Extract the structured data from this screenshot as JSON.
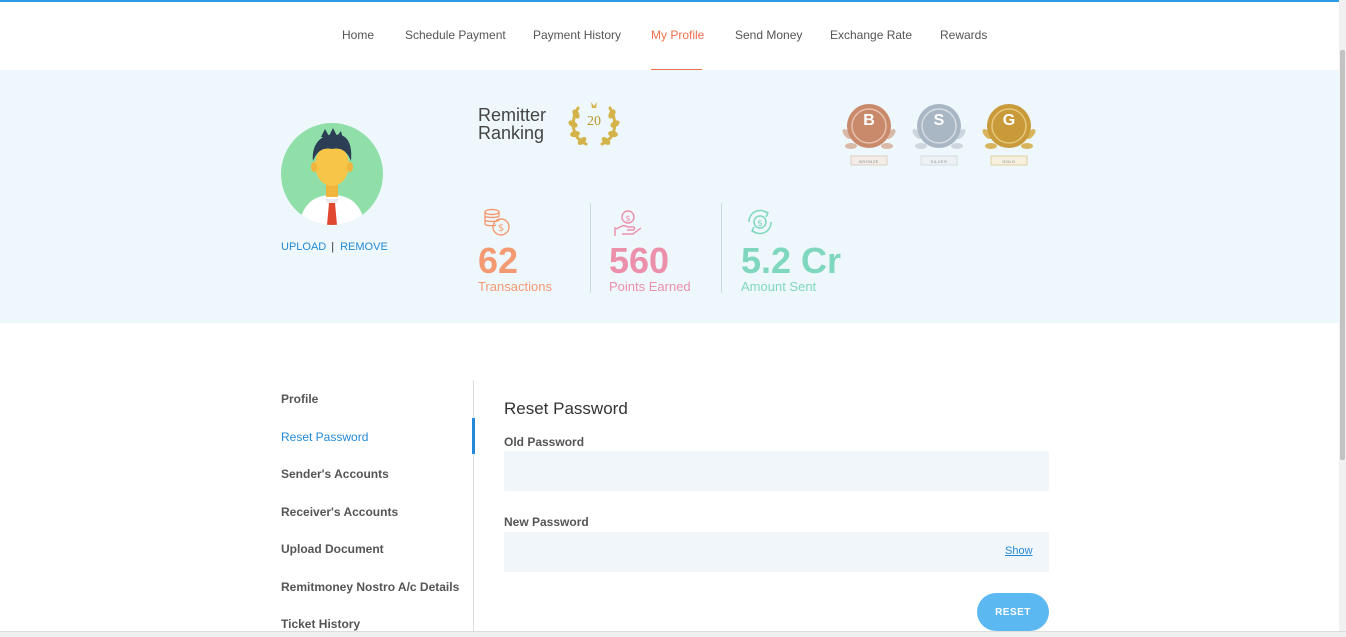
{
  "nav": {
    "items": [
      {
        "label": "Home"
      },
      {
        "label": "Schedule Payment"
      },
      {
        "label": "Payment History"
      },
      {
        "label": "My Profile"
      },
      {
        "label": "Send Money"
      },
      {
        "label": "Exchange Rate"
      },
      {
        "label": "Rewards"
      }
    ],
    "active_index": 3
  },
  "profile": {
    "upload_label": "UPLOAD",
    "separator": "|",
    "remove_label": "REMOVE"
  },
  "ranking": {
    "label_line1": "Remitter",
    "label_line2": "Ranking",
    "value": "20"
  },
  "medals": [
    {
      "letter": "B",
      "caption": "BRONZE",
      "color": "#c98a6c"
    },
    {
      "letter": "S",
      "caption": "SILVER",
      "color": "#a9b6c4"
    },
    {
      "letter": "G",
      "caption": "GOLD",
      "color": "#c99a3a"
    }
  ],
  "stats": [
    {
      "value": "62",
      "label": "Transactions",
      "color": "#f49a72",
      "icon": "coins-icon"
    },
    {
      "value": "560",
      "label": "Points Earned",
      "color": "#ec8faa",
      "icon": "hand-coin-icon"
    },
    {
      "value": "5.2 Cr",
      "label": "Amount Sent",
      "color": "#7fd7c0",
      "icon": "money-cycle-icon"
    }
  ],
  "sidebar": {
    "items": [
      {
        "label": "Profile"
      },
      {
        "label": "Reset Password"
      },
      {
        "label": "Sender's Accounts"
      },
      {
        "label": "Receiver's Accounts"
      },
      {
        "label": "Upload Document"
      },
      {
        "label": "Remitmoney Nostro A/c Details"
      },
      {
        "label": "Ticket History"
      }
    ],
    "active_index": 1
  },
  "form": {
    "title": "Reset Password",
    "old_label": "Old Password",
    "old_value": "",
    "new_label": "New Password",
    "new_value": "",
    "show_label": "Show",
    "reset_label": "RESET"
  },
  "colors": {
    "accent": "#ef6f4c",
    "link": "#2389d6",
    "hero_bg": "#eef8fc",
    "button": "#5cb8f0"
  }
}
